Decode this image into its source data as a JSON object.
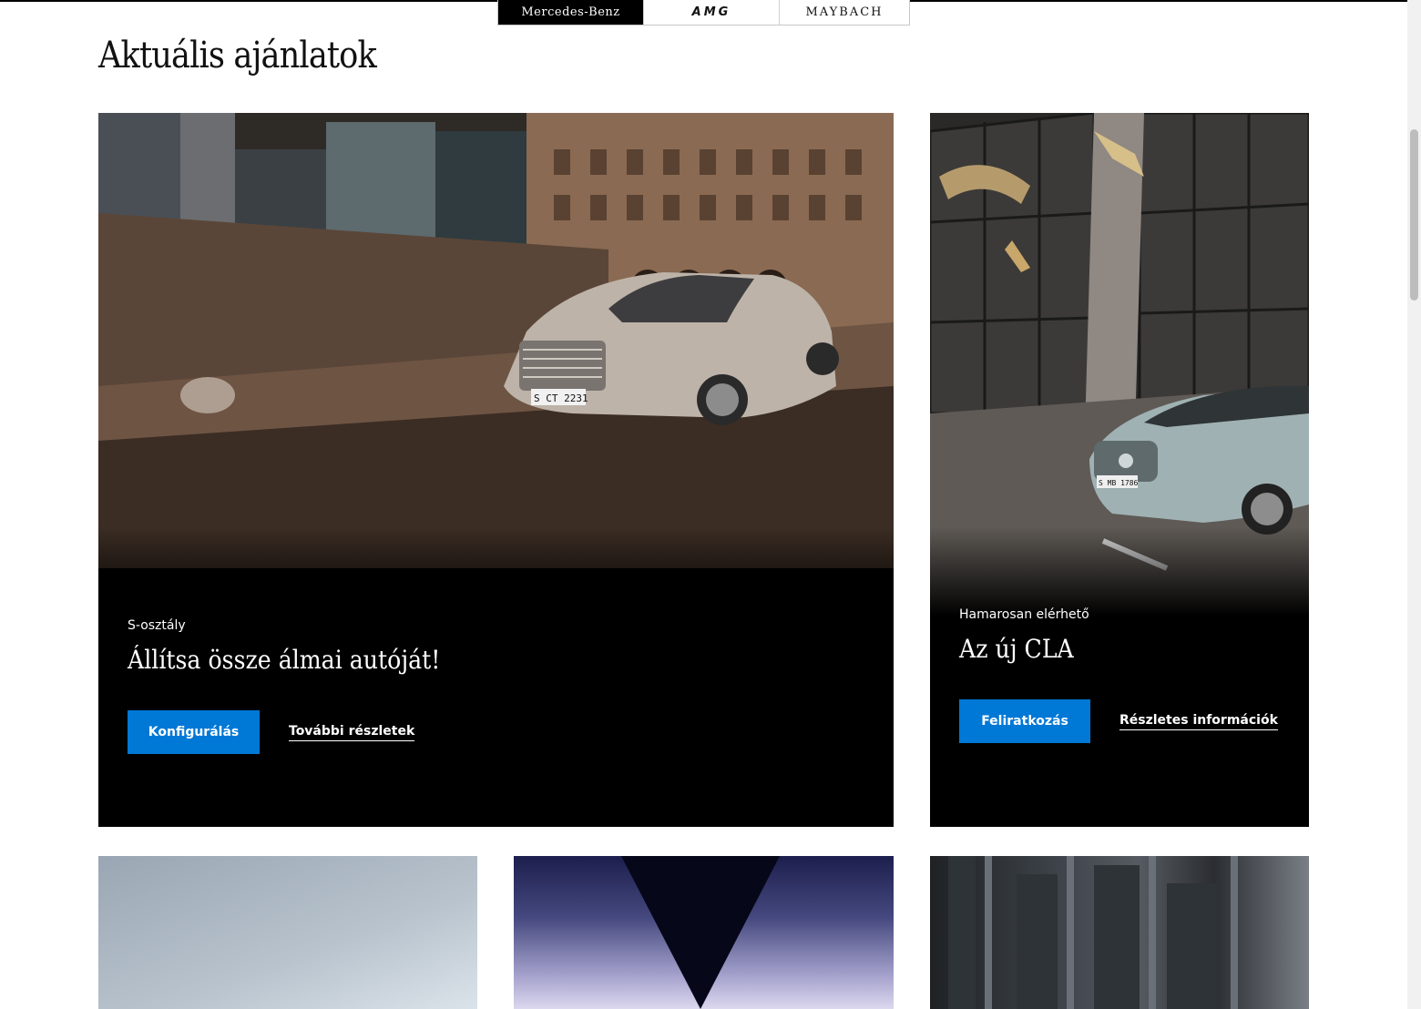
{
  "brand_tabs": [
    "Mercedes-Benz",
    "AMG",
    "MAYBACH"
  ],
  "section_title": "Aktuális ajánlatok",
  "cards": [
    {
      "eyebrow": "S-osztály",
      "headline": "Állítsa össze álmai autóját!",
      "primary_label": "Konfigurálás",
      "link_label": "További részletek",
      "plate": "S CT 2231"
    },
    {
      "eyebrow": "Hamarosan elérhető",
      "headline": "Az új CLA",
      "primary_label": "Feliratkozás",
      "link_label": "Részletes információk",
      "plate": "S MB 1786"
    }
  ],
  "colors": {
    "primary_button": "#0078d6",
    "card_background": "#000000",
    "page_background": "#ffffff"
  }
}
